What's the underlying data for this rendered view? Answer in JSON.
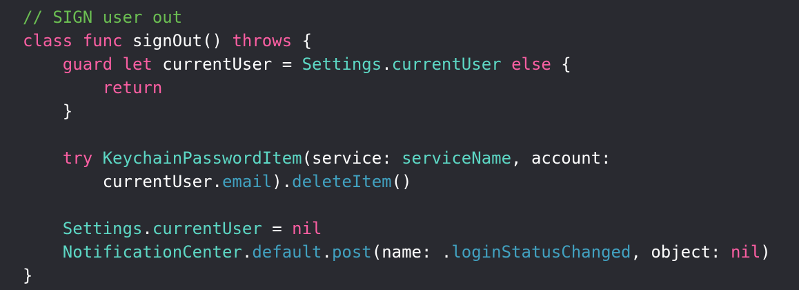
{
  "lines": [
    [
      {
        "text": "// SIGN user out",
        "kind": "comment"
      }
    ],
    [
      {
        "text": "class",
        "kind": "keyword"
      },
      {
        "text": " ",
        "kind": "plain"
      },
      {
        "text": "func",
        "kind": "keyword"
      },
      {
        "text": " signOut() ",
        "kind": "plain"
      },
      {
        "text": "throws",
        "kind": "keyword"
      },
      {
        "text": " {",
        "kind": "plain"
      }
    ],
    [
      {
        "text": "    ",
        "kind": "plain"
      },
      {
        "text": "guard",
        "kind": "keyword"
      },
      {
        "text": " ",
        "kind": "plain"
      },
      {
        "text": "let",
        "kind": "keyword"
      },
      {
        "text": " currentUser = ",
        "kind": "plain"
      },
      {
        "text": "Settings",
        "kind": "type"
      },
      {
        "text": ".",
        "kind": "plain"
      },
      {
        "text": "currentUser",
        "kind": "type"
      },
      {
        "text": " ",
        "kind": "plain"
      },
      {
        "text": "else",
        "kind": "keyword"
      },
      {
        "text": " {",
        "kind": "plain"
      }
    ],
    [
      {
        "text": "        ",
        "kind": "plain"
      },
      {
        "text": "return",
        "kind": "keyword"
      }
    ],
    [
      {
        "text": "    }",
        "kind": "plain"
      }
    ],
    [
      {
        "text": "",
        "kind": "plain"
      }
    ],
    [
      {
        "text": "    ",
        "kind": "plain"
      },
      {
        "text": "try",
        "kind": "keyword"
      },
      {
        "text": " ",
        "kind": "plain"
      },
      {
        "text": "KeychainPasswordItem",
        "kind": "type"
      },
      {
        "text": "(service: ",
        "kind": "plain"
      },
      {
        "text": "serviceName",
        "kind": "type"
      },
      {
        "text": ", account:",
        "kind": "plain"
      }
    ],
    [
      {
        "text": "        currentUser.",
        "kind": "plain"
      },
      {
        "text": "email",
        "kind": "member"
      },
      {
        "text": ").",
        "kind": "plain"
      },
      {
        "text": "deleteItem",
        "kind": "member"
      },
      {
        "text": "()",
        "kind": "plain"
      }
    ],
    [
      {
        "text": "",
        "kind": "plain"
      }
    ],
    [
      {
        "text": "    ",
        "kind": "plain"
      },
      {
        "text": "Settings",
        "kind": "type"
      },
      {
        "text": ".",
        "kind": "plain"
      },
      {
        "text": "currentUser",
        "kind": "type"
      },
      {
        "text": " = ",
        "kind": "plain"
      },
      {
        "text": "nil",
        "kind": "keyword"
      }
    ],
    [
      {
        "text": "    ",
        "kind": "plain"
      },
      {
        "text": "NotificationCenter",
        "kind": "type"
      },
      {
        "text": ".",
        "kind": "plain"
      },
      {
        "text": "default",
        "kind": "member"
      },
      {
        "text": ".",
        "kind": "plain"
      },
      {
        "text": "post",
        "kind": "member"
      },
      {
        "text": "(name: .",
        "kind": "plain"
      },
      {
        "text": "loginStatusChanged",
        "kind": "member"
      },
      {
        "text": ", object: ",
        "kind": "plain"
      },
      {
        "text": "nil",
        "kind": "keyword"
      },
      {
        "text": ")",
        "kind": "plain"
      }
    ],
    [
      {
        "text": "}",
        "kind": "plain"
      }
    ]
  ],
  "colors": {
    "background": "#292a30",
    "comment": "#6bbe52",
    "keyword": "#fc5fa3",
    "type": "#5dd8c5",
    "member": "#41a1c0",
    "plain": "#ffffff"
  }
}
